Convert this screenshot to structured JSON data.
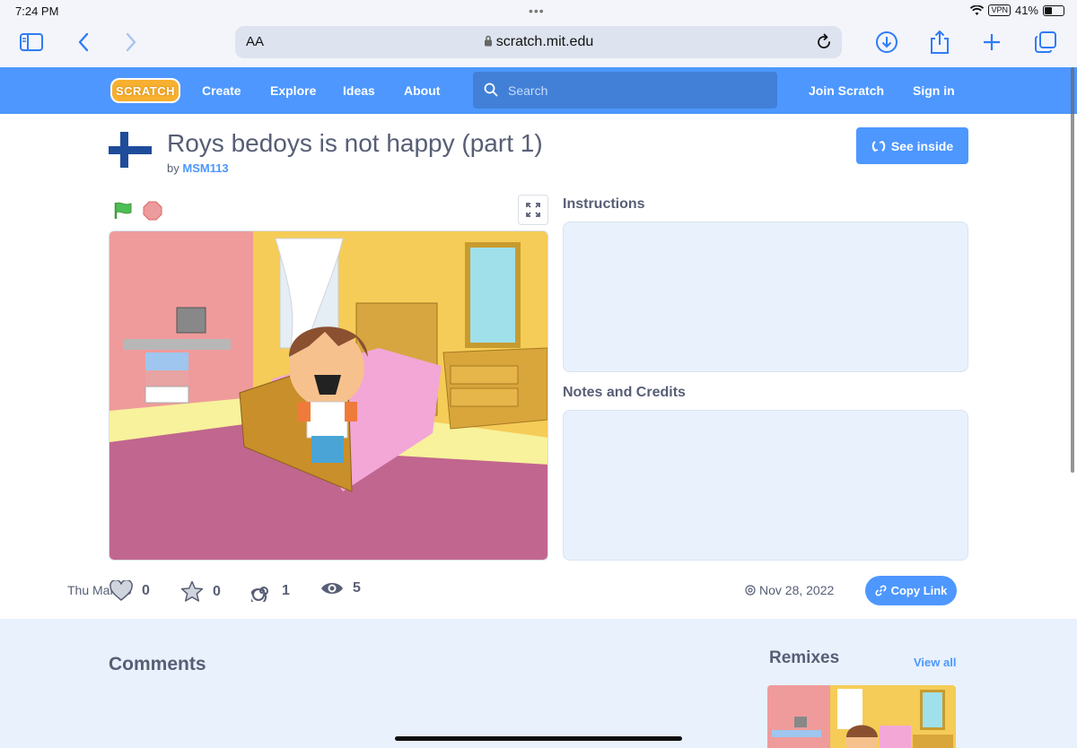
{
  "status_bar": {
    "time": "7:24 PM",
    "date": "Thu Mar 23",
    "vpn": "VPN",
    "battery": "41%",
    "battery_level": 0.41
  },
  "browser": {
    "text_size_label": "AA",
    "url": "scratch.mit.edu",
    "icons": [
      "sidebar-icon",
      "back-icon",
      "forward-icon",
      "lock-icon",
      "reload-icon",
      "download-icon",
      "share-icon",
      "new-tab-icon",
      "tabs-icon"
    ]
  },
  "nav": {
    "logo": "SCRATCH",
    "links": [
      "Create",
      "Explore",
      "Ideas",
      "About"
    ],
    "search_placeholder": "Search",
    "join": "Join Scratch",
    "signin": "Sign in"
  },
  "project": {
    "title": "Roys bedoys is not happy (part 1)",
    "by_label": "by",
    "author": "MSM113",
    "see_inside": "See inside",
    "instructions_label": "Instructions",
    "notes_label": "Notes and Credits",
    "instructions": "",
    "notes": ""
  },
  "stats": {
    "loves": "0",
    "favorites": "0",
    "remixes": "1",
    "views": "5"
  },
  "shared_date": "Nov 28, 2022",
  "copy_link": "Copy Link",
  "lower": {
    "comments_label": "Comments",
    "remixes_label": "Remixes",
    "view_all": "View all"
  },
  "colors": {
    "accent": "#4d97ff",
    "nav_bg": "#4d97ff",
    "text": "#575e75",
    "panel": "#e9f1fc"
  }
}
